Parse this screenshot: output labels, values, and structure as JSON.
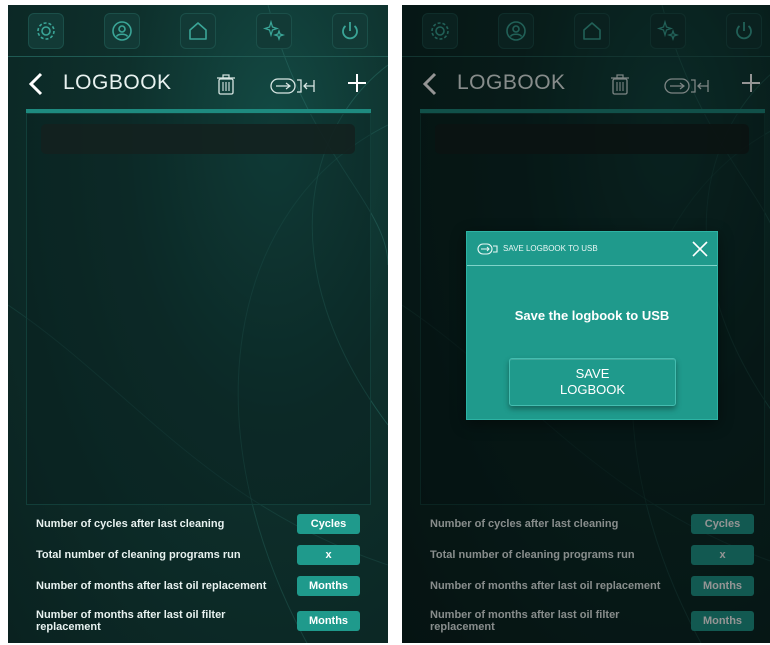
{
  "colors": {
    "background": "#0e302c",
    "accent": "#1f9a8c",
    "text": "#e8f2f0"
  },
  "icons": {
    "topbar": [
      "gear-icon",
      "user-icon",
      "home-icon",
      "sparkle-icon",
      "power-icon"
    ],
    "header": [
      "back-icon",
      "trash-icon",
      "usb-export-icon",
      "plus-icon"
    ]
  },
  "left": {
    "header": {
      "title": "LOGBOOK"
    },
    "stats": [
      {
        "label": "Number of cycles after last cleaning",
        "badge": "Cycles"
      },
      {
        "label": "Total number of cleaning programs run",
        "badge": "x"
      },
      {
        "label": "Number of months after last oil replacement",
        "badge": "Months"
      },
      {
        "label": "Number of months after last oil filter replacement",
        "badge": "Months"
      }
    ]
  },
  "right": {
    "header": {
      "title": "LOGBOOK"
    },
    "stats": [
      {
        "label": "Number of cycles after last cleaning",
        "badge": "Cycles"
      },
      {
        "label": "Total number of cleaning programs run",
        "badge": "x"
      },
      {
        "label": "Number of months after last oil replacement",
        "badge": "Months"
      },
      {
        "label": "Number of months after last oil filter replacement",
        "badge": "Months"
      }
    ],
    "modal": {
      "title": "SAVE LOGBOOK TO USB",
      "message": "Save the logbook to USB",
      "button_line1": "SAVE",
      "button_line2": "LOGBOOK"
    }
  }
}
